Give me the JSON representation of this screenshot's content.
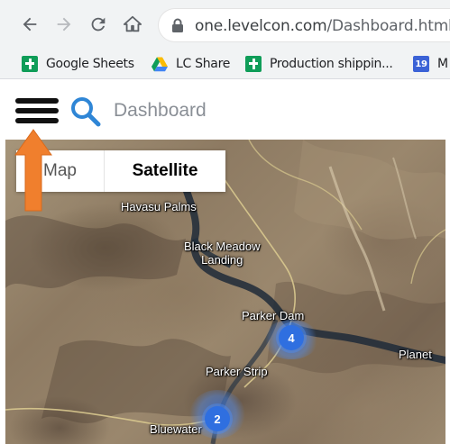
{
  "browser": {
    "url_host": "one.levelcon.com",
    "url_path": "/Dashboard.html",
    "icons": [
      "back-arrow-icon",
      "forward-arrow-icon",
      "reload-icon",
      "home-icon",
      "lock-icon"
    ]
  },
  "bookmarks": [
    {
      "label": "Google Sheets",
      "icon": "google-sheets-icon"
    },
    {
      "label": "LC Share",
      "icon": "google-drive-icon"
    },
    {
      "label": "Production shippin...",
      "icon": "google-sheets-icon"
    },
    {
      "label": "M",
      "icon": "calendar-icon",
      "icon_text": "19"
    }
  ],
  "app": {
    "title": "Dashboard",
    "icons": [
      "hamburger-menu-icon",
      "search-icon"
    ],
    "annotation": {
      "icon": "orange-up-arrow",
      "color": "#f07f2d"
    }
  },
  "map": {
    "type_toggle": {
      "map_label": "Map",
      "satellite_label": "Satellite",
      "selected": "Satellite"
    },
    "places": [
      "Havasu Palms",
      "Black Meadow Landing",
      "Parker Dam",
      "Planet",
      "Parker Strip",
      "Bluewater"
    ],
    "black_meadow_line1": "Black Meadow",
    "black_meadow_line2": "Landing",
    "clusters": [
      {
        "count": "4",
        "color": "#2f6fe0"
      },
      {
        "count": "2",
        "color": "#2f6fe0"
      }
    ]
  }
}
